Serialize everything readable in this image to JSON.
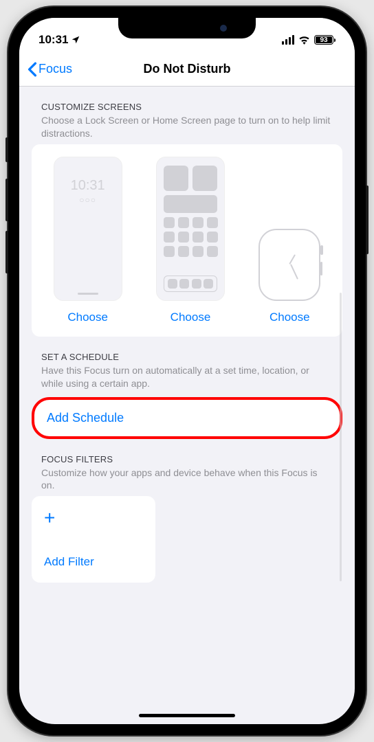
{
  "status": {
    "time": "10:31",
    "battery": "93"
  },
  "nav": {
    "back": "Focus",
    "title": "Do Not Disturb"
  },
  "customize": {
    "title": "CUSTOMIZE SCREENS",
    "desc": "Choose a Lock Screen or Home Screen page to turn on to help limit distractions.",
    "lock_time": "10:31",
    "lock_dots": "○○○",
    "choose1": "Choose",
    "choose2": "Choose",
    "choose3": "Choose"
  },
  "schedule": {
    "title": "SET A SCHEDULE",
    "desc": "Have this Focus turn on automatically at a set time, location, or while using a certain app.",
    "add": "Add Schedule"
  },
  "filters": {
    "title": "FOCUS FILTERS",
    "desc": "Customize how your apps and device behave when this Focus is on.",
    "add": "Add Filter"
  }
}
